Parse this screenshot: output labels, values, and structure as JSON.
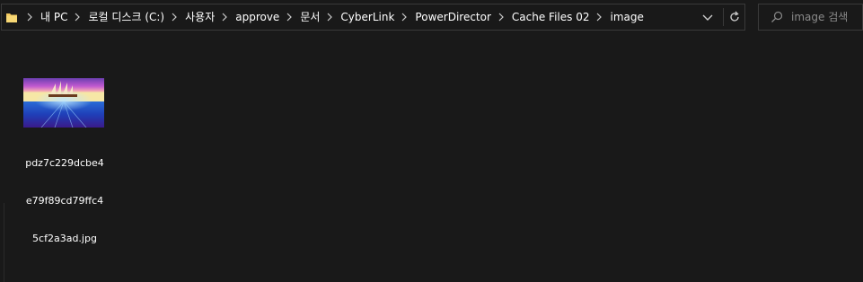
{
  "address_bar": {
    "folder_icon": "folder-icon",
    "breadcrumbs": [
      "내 PC",
      "로컬 디스크 (C:)",
      "사용자",
      "approve",
      "문서",
      "CyberLink",
      "PowerDirector",
      "Cache Files 02",
      "image"
    ],
    "dropdown_icon": "chevron-down-icon",
    "refresh_icon": "refresh-icon"
  },
  "search": {
    "icon": "search-icon",
    "placeholder": "image 검색"
  },
  "files": [
    {
      "name_lines": [
        "pdz7c229dcbe4",
        "e79f89cd79ffc4",
        "5cf2a3ad.jpg"
      ],
      "thumbnail": "sailing-ship-image"
    }
  ],
  "colors": {
    "background": "#191919",
    "border": "#3a3a3a",
    "text": "#ffffff",
    "placeholder": "#8a8a8a",
    "folder": "#f0c75e"
  }
}
